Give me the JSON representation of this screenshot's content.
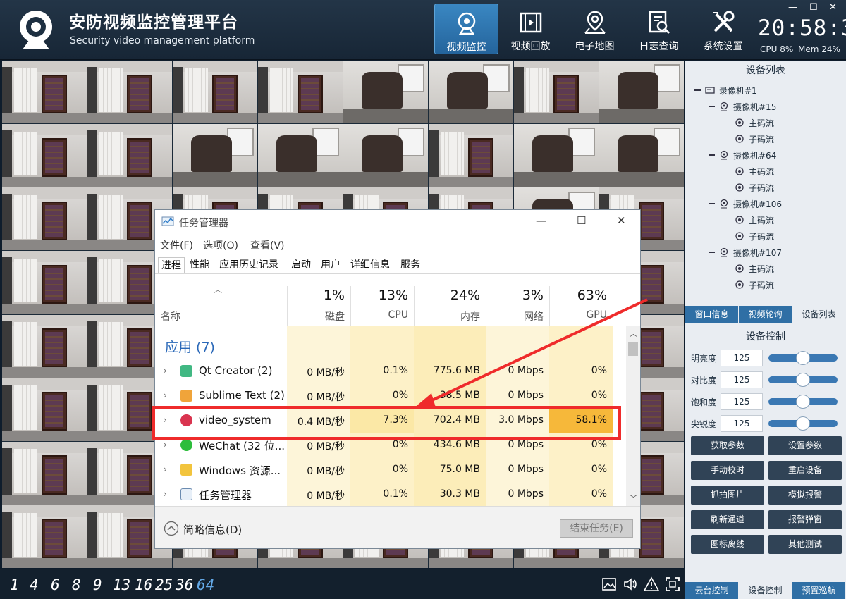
{
  "header": {
    "title": "安防视频监控管理平台",
    "subtitle": "Security video management platform",
    "nav": [
      {
        "label": "视频监控",
        "icon": "camera-icon"
      },
      {
        "label": "视频回放",
        "icon": "film-icon"
      },
      {
        "label": "电子地图",
        "icon": "map-pin-icon"
      },
      {
        "label": "日志查询",
        "icon": "log-search-icon"
      },
      {
        "label": "系统设置",
        "icon": "wrench-tools-icon"
      }
    ],
    "clock": "20:58:36",
    "cpu": "CPU 8%",
    "mem": "Mem 24%"
  },
  "layout_bar": {
    "options": [
      "1",
      "4",
      "6",
      "8",
      "9",
      "13",
      "16",
      "25",
      "36",
      "64"
    ],
    "active": "64"
  },
  "right_panel": {
    "device_list_title": "设备列表",
    "tree": {
      "recorder": "录像机#1",
      "cameras": [
        {
          "name": "摄像机#15",
          "streams": [
            "主码流",
            "子码流"
          ]
        },
        {
          "name": "摄像机#64",
          "streams": [
            "主码流",
            "子码流"
          ]
        },
        {
          "name": "摄像机#106",
          "streams": [
            "主码流",
            "子码流"
          ]
        },
        {
          "name": "摄像机#107",
          "streams": [
            "主码流",
            "子码流"
          ]
        }
      ]
    },
    "tabs": [
      "窗口信息",
      "视频轮询",
      "设备列表"
    ],
    "device_control_title": "设备控制",
    "controls": [
      {
        "label": "明亮度",
        "value": "125",
        "level": 0.5
      },
      {
        "label": "对比度",
        "value": "125",
        "level": 0.5
      },
      {
        "label": "饱和度",
        "value": "125",
        "level": 0.5
      },
      {
        "label": "尖锐度",
        "value": "125",
        "level": 0.5
      }
    ],
    "buttons": [
      "获取参数",
      "设置参数",
      "手动校时",
      "重启设备",
      "抓拍图片",
      "模拟报警",
      "刷新通道",
      "报警弹窗",
      "图标离线",
      "其他测试"
    ],
    "bottom_tabs": [
      "云台控制",
      "设备控制",
      "预置巡航"
    ]
  },
  "task_manager": {
    "title": "任务管理器",
    "menu": [
      "文件(F)",
      "选项(O)",
      "查看(V)"
    ],
    "tabs": [
      "进程",
      "性能",
      "应用历史记录",
      "启动",
      "用户",
      "详细信息",
      "服务"
    ],
    "columns": {
      "name": "名称",
      "disk": {
        "pct": "1%",
        "label": "磁盘"
      },
      "cpu": {
        "pct": "13%",
        "label": "CPU"
      },
      "mem": {
        "pct": "24%",
        "label": "内存"
      },
      "net": {
        "pct": "3%",
        "label": "网络"
      },
      "gpu": {
        "pct": "63%",
        "label": "GPU"
      }
    },
    "group": "应用 (7)",
    "rows": [
      {
        "name": "Qt Creator (2)",
        "disk": "0 MB/秒",
        "cpu": "0.1%",
        "mem": "775.6 MB",
        "net": "0 Mbps",
        "gpu": "0%"
      },
      {
        "name": "Sublime Text (2)",
        "disk": "0 MB/秒",
        "cpu": "0%",
        "mem": "38.5 MB",
        "net": "0 Mbps",
        "gpu": "0%"
      },
      {
        "name": "video_system",
        "disk": "0.4 MB/秒",
        "cpu": "7.3%",
        "mem": "702.4 MB",
        "net": "3.0 Mbps",
        "gpu": "58.1%"
      },
      {
        "name": "WeChat (32 位...",
        "disk": "0 MB/秒",
        "cpu": "0%",
        "mem": "434.6 MB",
        "net": "0 Mbps",
        "gpu": "0%"
      },
      {
        "name": "Windows 资源...",
        "disk": "0 MB/秒",
        "cpu": "0%",
        "mem": "75.0 MB",
        "net": "0 Mbps",
        "gpu": "0%"
      },
      {
        "name": "任务管理器",
        "disk": "0 MB/秒",
        "cpu": "0.1%",
        "mem": "30.3 MB",
        "net": "0 Mbps",
        "gpu": "0%"
      }
    ],
    "fewer_details": "简略信息(D)",
    "end_task": "结束任务(E)"
  },
  "colors": {
    "accent": "#2f6fa5",
    "highlight": "#ef2b2b",
    "gpu_hot": "#f6b83a"
  }
}
